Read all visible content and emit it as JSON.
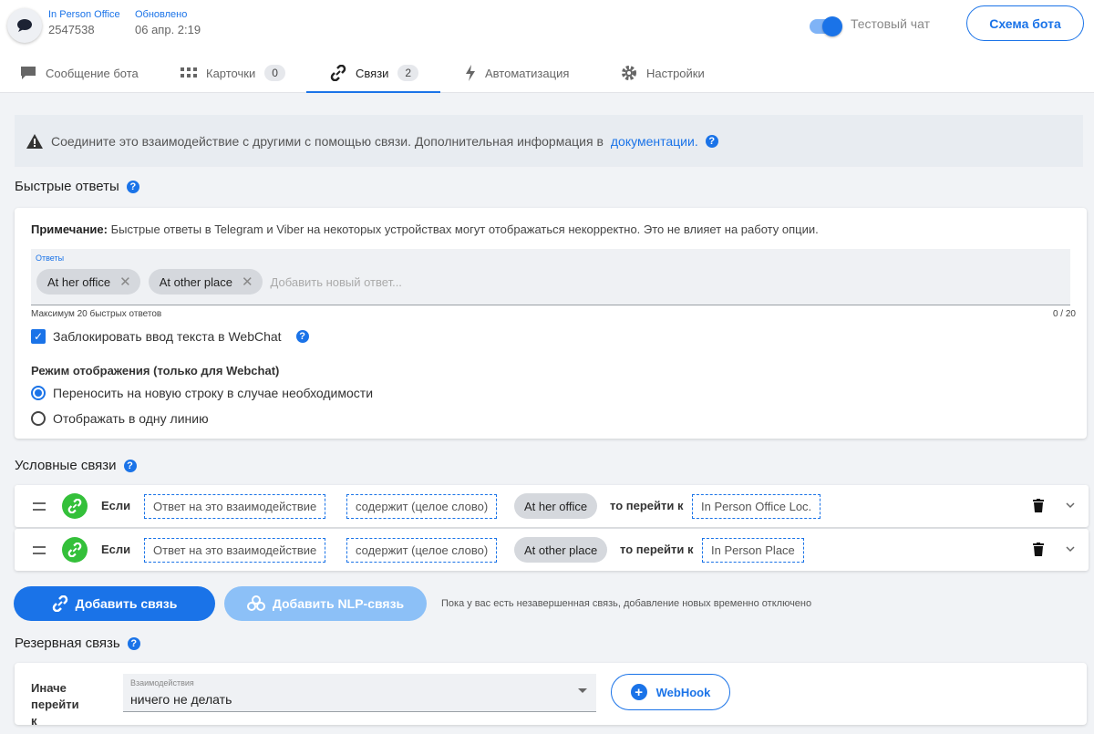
{
  "header": {
    "bot_name": "In Person Office",
    "bot_id": "2547538",
    "updated_label": "Обновлено",
    "updated_value": "06 апр. 2:19",
    "test_chat_label": "Тестовый чат",
    "schema_button": "Схема бота"
  },
  "tabs": [
    {
      "label": "Сообщение бота",
      "icon": "message-icon"
    },
    {
      "label": "Карточки",
      "icon": "cards-icon",
      "count": "0"
    },
    {
      "label": "Связи",
      "icon": "link-icon",
      "count": "2",
      "active": true
    },
    {
      "label": "Автоматизация",
      "icon": "lightning-icon"
    },
    {
      "label": "Настройки",
      "icon": "gear-icon"
    }
  ],
  "notice": {
    "text": "Соедините это взаимодействие с другими с помощью связи. Дополнительная информация в",
    "link": "документации."
  },
  "quick_replies": {
    "title": "Быстрые ответы",
    "note_bold": "Примечание:",
    "note_text": "Быстрые ответы в Telegram и Viber на некоторых устройствах могут отображаться некорректно. Это не влияет на работу опции.",
    "answers_label": "Ответы",
    "answers": [
      "At her office",
      "At other place"
    ],
    "add_placeholder": "Добавить новый ответ...",
    "max_text": "Максимум 20 быстрых ответов",
    "counter": "0 / 20",
    "block_input_label": "Заблокировать ввод текста в WebChat",
    "block_input_checked": true,
    "mode_title": "Режим отображения (только для Webchat)",
    "mode_options": [
      "Переносить на новую строку в случае необходимости",
      "Отображать в одну линию"
    ],
    "mode_selected": 0
  },
  "conditional": {
    "title": "Условные связи",
    "rows": [
      {
        "if": "Если",
        "source": "Ответ на это взаимодействие",
        "operator": "содержит (целое слово)",
        "value": "At her office",
        "then": "то перейти к",
        "target": "In Person Office Loc."
      },
      {
        "if": "Если",
        "source": "Ответ на это взаимодействие",
        "operator": "содержит (целое слово)",
        "value": "At other place",
        "then": "то перейти к",
        "target": "In Person Place"
      }
    ],
    "add_button": "Добавить связь",
    "add_nlp_button": "Добавить NLP-связь",
    "disabled_note": "Пока у вас есть незавершенная связь, добавление новых временно отключено"
  },
  "fallback": {
    "title": "Резервная связь",
    "else_label": "Иначе перейти к",
    "select_label": "Взаимодействия",
    "select_value": "ничего не делать",
    "webhook_button": "WebHook"
  },
  "colors": {
    "accent": "#1a73e8",
    "link_green": "#34c03a",
    "background": "#f1f3f6"
  }
}
